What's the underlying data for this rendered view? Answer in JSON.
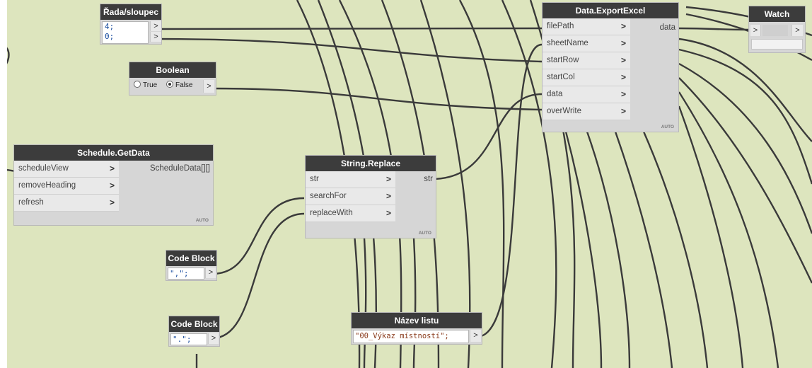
{
  "nodes": {
    "rada_sloupec": {
      "title": "Řada/sloupec",
      "lines": [
        "4;",
        "0;"
      ],
      "out_glyph": ">"
    },
    "boolean": {
      "title": "Boolean",
      "option_true": "True",
      "option_false": "False",
      "selected": "False",
      "out_glyph": ">"
    },
    "schedule_getdata": {
      "title": "Schedule.GetData",
      "inputs": [
        "scheduleView",
        "removeHeading",
        "refresh"
      ],
      "output": "ScheduleData[][]",
      "lacing": "AUTO"
    },
    "string_replace": {
      "title": "String.Replace",
      "inputs": [
        "str",
        "searchFor",
        "replaceWith"
      ],
      "output": "str",
      "lacing": "AUTO"
    },
    "code_block_1": {
      "title": "Code Block",
      "code": "\",\";",
      "out_glyph": ">"
    },
    "code_block_2": {
      "title": "Code Block",
      "code": "\".\";",
      "out_glyph": ">"
    },
    "nazev_listu": {
      "title": "Název listu",
      "code": "\"00_Výkaz místností\";",
      "out_glyph": ">"
    },
    "data_exportexcel": {
      "title": "Data.ExportExcel",
      "inputs": [
        "filePath",
        "sheetName",
        "startRow",
        "startCol",
        "data",
        "overWrite"
      ],
      "output": "data",
      "lacing": "AUTO"
    },
    "watch": {
      "title": "Watch",
      "in_glyph": ">",
      "out_glyph": ">"
    }
  },
  "chevron": ">",
  "colors": {
    "canvas": "#dde5be",
    "node_header": "#3c3c3c",
    "wire": "#3a3a3a",
    "code_text": "#1c4fa0"
  }
}
